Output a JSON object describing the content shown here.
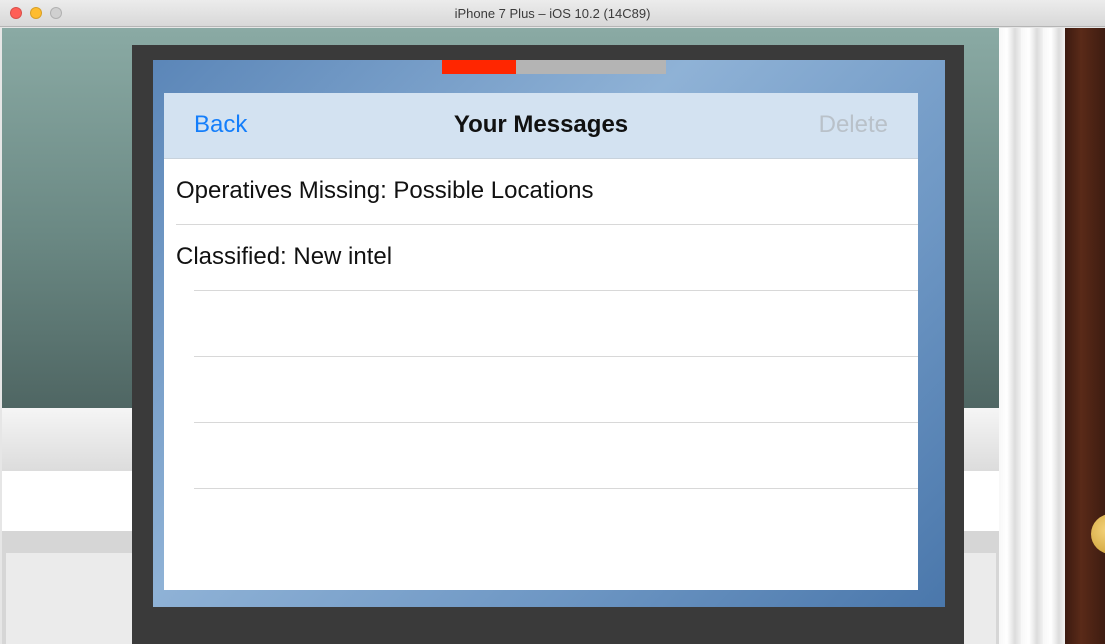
{
  "window": {
    "title": "iPhone 7 Plus – iOS 10.2 (14C89)"
  },
  "progress": {
    "fraction": 0.33,
    "fill_color": "#ff2600",
    "track_color": "#b4b4b4"
  },
  "nav": {
    "back_label": "Back",
    "title": "Your Messages",
    "delete_label": "Delete"
  },
  "messages": [
    {
      "subject": "Operatives Missing: Possible Locations"
    },
    {
      "subject": "Classified: New intel"
    },
    {
      "subject": ""
    },
    {
      "subject": ""
    },
    {
      "subject": ""
    },
    {
      "subject": ""
    }
  ],
  "colors": {
    "accent": "#147efb",
    "disabled": "#b9c1c9"
  }
}
